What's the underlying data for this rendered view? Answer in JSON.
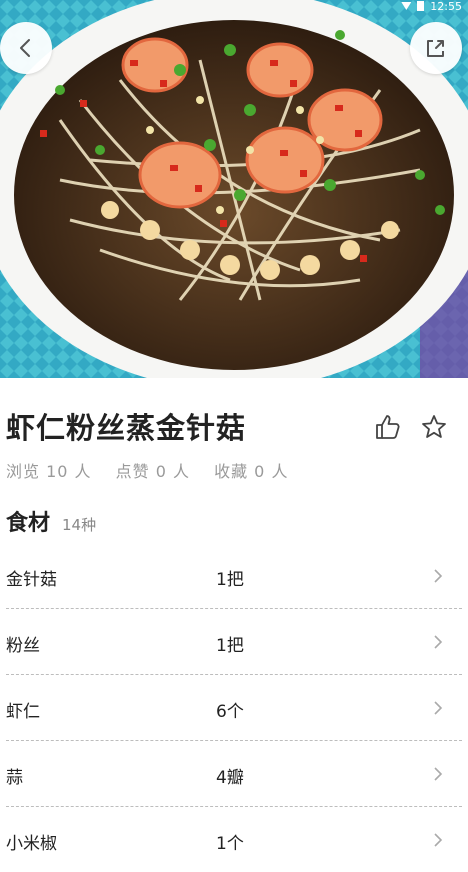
{
  "status": {
    "time": "12:55"
  },
  "recipe": {
    "title": "虾仁粉丝蒸金针菇",
    "stats": [
      "浏览 10 人",
      "点赞 0 人",
      "收藏 0 人"
    ]
  },
  "ingredients": {
    "section_title": "食材",
    "count_label": "14种",
    "items": [
      {
        "name": "金针菇",
        "qty": "1把"
      },
      {
        "name": "粉丝",
        "qty": "1把"
      },
      {
        "name": "虾仁",
        "qty": "6个"
      },
      {
        "name": "蒜",
        "qty": "4瓣"
      },
      {
        "name": "小米椒",
        "qty": "1个"
      }
    ]
  },
  "icons": {
    "back": "chevron-left-icon",
    "share": "share-icon",
    "like": "thumbs-up-icon",
    "favorite": "star-icon",
    "row_arrow": "chevron-right-icon"
  }
}
